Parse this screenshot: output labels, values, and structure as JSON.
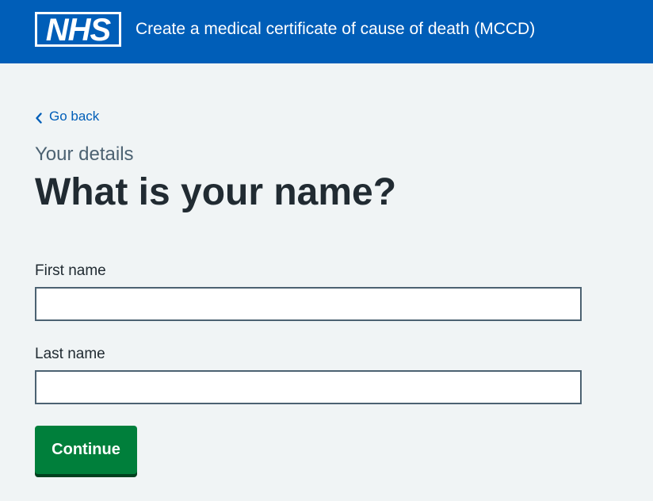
{
  "header": {
    "logo_text": "NHS",
    "service_name": "Create a medical certificate of cause of death (MCCD)"
  },
  "nav": {
    "back_label": "Go back"
  },
  "page": {
    "caption": "Your details",
    "title": "What is your name?"
  },
  "form": {
    "first_name_label": "First name",
    "first_name_value": "",
    "last_name_label": "Last name",
    "last_name_value": "",
    "continue_label": "Continue"
  },
  "colors": {
    "header_blue": "#005eb8",
    "button_green": "#007f3b",
    "background": "#f0f4f5",
    "text": "#212b32",
    "secondary_text": "#4c6272"
  },
  "icons": {
    "back": "chevron-left-icon"
  }
}
